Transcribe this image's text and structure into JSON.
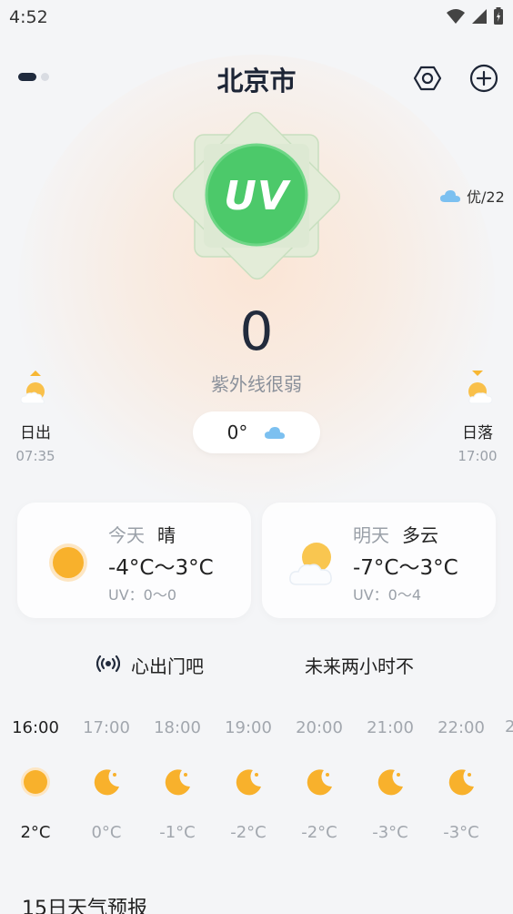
{
  "status_bar": {
    "time": "4:52"
  },
  "header": {
    "city": "北京市"
  },
  "uv": {
    "badge": "UV",
    "value": "0",
    "description": "紫外线很弱"
  },
  "aqi": {
    "label": "优/22"
  },
  "current": {
    "temperature": "0°"
  },
  "sun": {
    "sunrise_label": "日出",
    "sunrise_time": "07:35",
    "sunset_label": "日落",
    "sunset_time": "17:00"
  },
  "today": {
    "day": "今天",
    "weather": "晴",
    "temp": "-4°C～3°C",
    "uv": "UV：0～0"
  },
  "tomorrow": {
    "day": "明天",
    "weather": "多云",
    "temp": "-7°C～3°C",
    "uv": "UV：0～4"
  },
  "tips": {
    "tip1": "心出门吧",
    "tip2": "未来两小时不"
  },
  "hourly": [
    {
      "time": "16:00",
      "temp": "2°C",
      "icon": "sun-icon",
      "now": true
    },
    {
      "time": "17:00",
      "temp": "0°C",
      "icon": "moon-icon"
    },
    {
      "time": "18:00",
      "temp": "-1°C",
      "icon": "moon-icon"
    },
    {
      "time": "19:00",
      "temp": "-2°C",
      "icon": "moon-icon"
    },
    {
      "time": "20:00",
      "temp": "-2°C",
      "icon": "moon-icon"
    },
    {
      "time": "21:00",
      "temp": "-3°C",
      "icon": "moon-icon"
    },
    {
      "time": "22:00",
      "temp": "-3°C",
      "icon": "moon-icon"
    }
  ],
  "hourly_more": "2",
  "forecast": {
    "title": "15日天气预报"
  },
  "colors": {
    "uv_green": "#4cc96a",
    "sun_orange": "#f7b733",
    "dark_text": "#222b3c"
  }
}
